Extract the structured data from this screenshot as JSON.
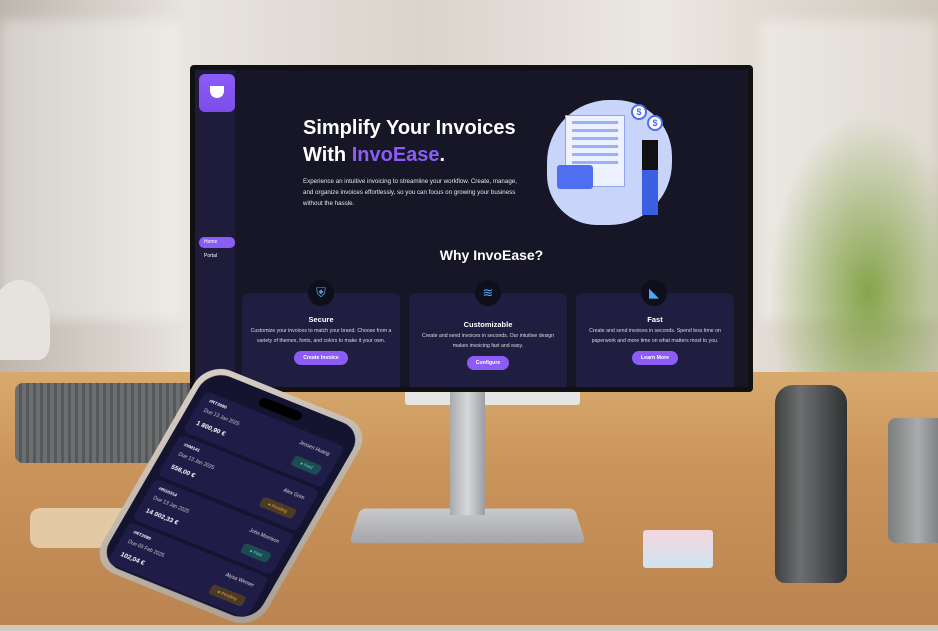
{
  "site": {
    "sidebar": {
      "items": [
        {
          "label": "Home",
          "active": true
        },
        {
          "label": "Portal",
          "active": false
        }
      ]
    },
    "hero": {
      "title_line1": "Simplify Your Invoices",
      "title_prefix": "With ",
      "brand": "InvoEase",
      "title_suffix": ".",
      "description": "Experience an intuitive invoicing to streamline your workflow. Create, manage, and organize invoices effortlessly, so you can focus on growing your business without the hassle."
    },
    "why_title": "Why InvoEase?",
    "features": [
      {
        "icon": "shield-icon",
        "title": "Secure",
        "description": "Customize your invoices to match your brand. Choose from a variety of themes, fonts, and colors to make it your own.",
        "button": "Create Invoice"
      },
      {
        "icon": "sliders-icon",
        "title": "Customizable",
        "description": "Create and send invoices in seconds. Our intuitive design makes invoicing fast and easy.",
        "button": "Configure"
      },
      {
        "icon": "fast-icon",
        "title": "Fast",
        "description": "Create and send invoices in seconds. Spend less time on paperwork and more time on what matters most to you.",
        "button": "Learn More"
      }
    ],
    "illustration_coin": "$"
  },
  "phone": {
    "invoices": [
      {
        "id": "#RT3080",
        "due": "Due 13 Jan 2025",
        "client": "Jensen Huang",
        "amount": "1 800,90 €",
        "status": "Paid"
      },
      {
        "id": "#XM141",
        "due": "Due 13 Jan 2025",
        "client": "Alex Grim",
        "amount": "556,00 €",
        "status": "Pending"
      },
      {
        "id": "#RG0314",
        "due": "Due 13 Jan 2025",
        "client": "John Morrison",
        "amount": "14 002,33 €",
        "status": "Paid"
      },
      {
        "id": "#RT2080",
        "due": "Due 05 Feb 2025",
        "client": "Alysa Werner",
        "amount": "102,04 €",
        "status": "Pending"
      }
    ]
  },
  "colors": {
    "accent": "#8b5cf6",
    "background": "#161626",
    "card": "#1f1d40",
    "paid": "#5ee0c5",
    "pending": "#f0a640"
  }
}
